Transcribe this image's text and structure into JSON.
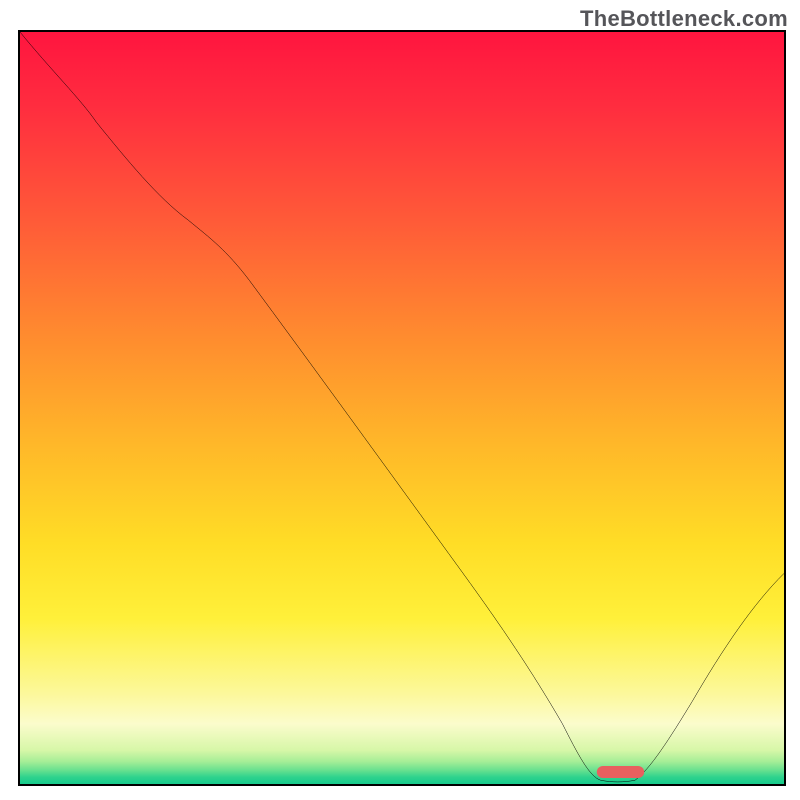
{
  "watermark": "TheBottleneck.com",
  "chart_data": {
    "type": "line",
    "title": "",
    "xlabel": "",
    "ylabel": "",
    "xlim": [
      0,
      100
    ],
    "ylim": [
      0,
      100
    ],
    "series": [
      {
        "name": "curve",
        "x": [
          0,
          8,
          17,
          24,
          40,
          55,
          66,
          71,
          76,
          80,
          85,
          92,
          100
        ],
        "values": [
          100,
          91,
          80,
          74,
          52,
          31,
          12,
          4,
          0,
          0,
          4,
          14,
          28
        ]
      }
    ],
    "marker": {
      "x": 78,
      "y": 1.5,
      "color": "#e8605f"
    },
    "gradient_stops": [
      {
        "pos": 0,
        "color": "#ff153f"
      },
      {
        "pos": 0.55,
        "color": "#ffb829"
      },
      {
        "pos": 0.88,
        "color": "#fcf89b"
      },
      {
        "pos": 1.0,
        "color": "#16cb8c"
      }
    ]
  }
}
